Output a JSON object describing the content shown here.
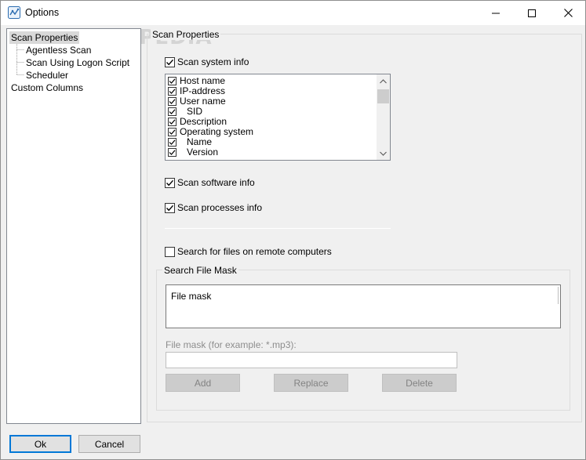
{
  "window": {
    "title": "Options",
    "app_icon": "network-scanner-icon",
    "controls": [
      "minimize-icon",
      "maximize-icon",
      "close-icon"
    ]
  },
  "watermark": "SOFTPEDIA",
  "tree": {
    "items": [
      {
        "label": "Scan Properties",
        "selected": true
      },
      {
        "label": "Agentless Scan",
        "child": true
      },
      {
        "label": "Scan Using Logon Script",
        "child": true
      },
      {
        "label": "Scheduler",
        "child": true
      },
      {
        "label": "Custom Columns"
      }
    ]
  },
  "scan_properties": {
    "group_title": "Scan Properties",
    "scan_system_info": {
      "label": "Scan system info",
      "checked": true
    },
    "system_info_items": [
      {
        "label": "Host name",
        "checked": true
      },
      {
        "label": "IP-address",
        "checked": true
      },
      {
        "label": "User name",
        "checked": true
      },
      {
        "label": "SID",
        "checked": true,
        "indent": true
      },
      {
        "label": "Description",
        "checked": true
      },
      {
        "label": "Operating system",
        "checked": true
      },
      {
        "label": "Name",
        "checked": true,
        "indent": true
      },
      {
        "label": "Version",
        "checked": true,
        "indent": true
      }
    ],
    "scan_software_info": {
      "label": "Scan software info",
      "checked": true
    },
    "scan_processes_info": {
      "label": "Scan processes info",
      "checked": true
    },
    "search_files": {
      "label": "Search for files on remote computers",
      "checked": false
    }
  },
  "search_file_mask": {
    "group_title": "Search File Mask",
    "list_header": "File mask",
    "input_label": "File mask (for example: *.mp3):",
    "input_value": "",
    "buttons": {
      "add": "Add",
      "replace": "Replace",
      "delete": "Delete"
    }
  },
  "footer": {
    "ok": "Ok",
    "cancel": "Cancel"
  },
  "colors": {
    "accent": "#0078d7",
    "selection": "#d9d9d9"
  }
}
